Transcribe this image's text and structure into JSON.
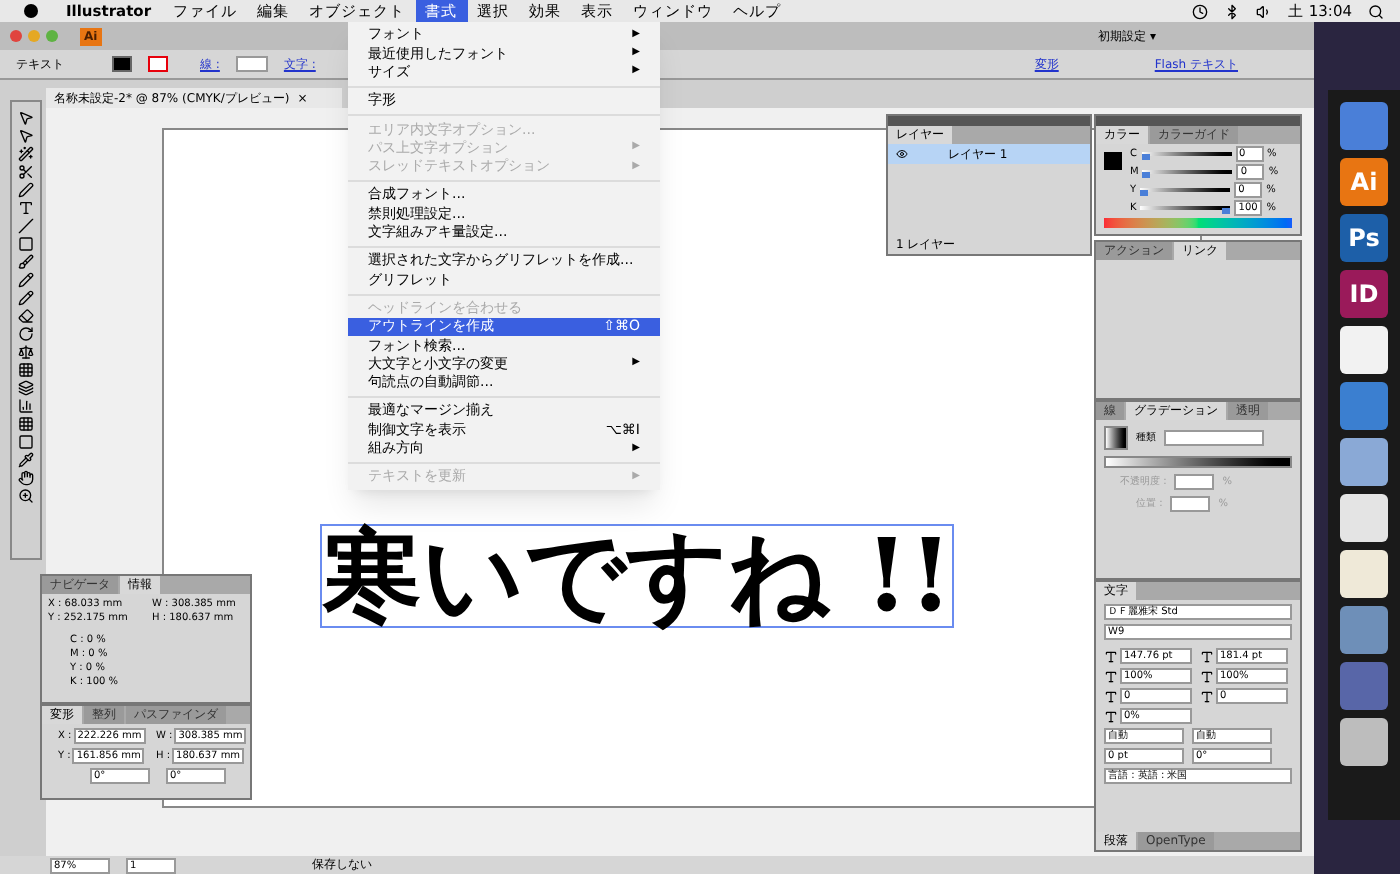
{
  "menubar": {
    "app": "Illustrator",
    "menus": [
      {
        "label": "ファイル",
        "selected": false
      },
      {
        "label": "編集",
        "selected": false
      },
      {
        "label": "オブジェクト",
        "selected": false
      },
      {
        "label": "書式",
        "selected": true
      },
      {
        "label": "選択",
        "selected": false
      },
      {
        "label": "効果",
        "selected": false
      },
      {
        "label": "表示",
        "selected": false
      },
      {
        "label": "ウィンドウ",
        "selected": false
      },
      {
        "label": "ヘルプ",
        "selected": false
      }
    ],
    "clock": "土 13:04"
  },
  "window": {
    "app_badge": "Ai",
    "workspace": "初期設定",
    "workspace_caret": "▾"
  },
  "control_bar": {
    "mode": "テキスト",
    "stroke_label": "線 :",
    "char_label": "文字 :",
    "transform_link": "変形",
    "flash_link": "Flash テキスト"
  },
  "document_tab": {
    "title": "名称未設定-2* @ 87% (CMYK/プレビュー)",
    "close": "×"
  },
  "menu": [
    {
      "kind": "item",
      "label": "フォント",
      "arrow": "▶",
      "disabled": false,
      "selected": false
    },
    {
      "kind": "item",
      "label": "最近使用したフォント",
      "arrow": "▶",
      "disabled": false,
      "selected": false
    },
    {
      "kind": "item",
      "label": "サイズ",
      "arrow": "▶",
      "disabled": false,
      "selected": false
    },
    {
      "kind": "separator"
    },
    {
      "kind": "item",
      "label": "字形",
      "disabled": false,
      "selected": false
    },
    {
      "kind": "separator"
    },
    {
      "kind": "item",
      "label": "エリア内文字オプション...",
      "disabled": true,
      "selected": false
    },
    {
      "kind": "item",
      "label": "パス上文字オプション",
      "arrow": "▶",
      "disabled": true,
      "selected": false
    },
    {
      "kind": "item",
      "label": "スレッドテキストオプション",
      "arrow": "▶",
      "disabled": true,
      "selected": false
    },
    {
      "kind": "separator"
    },
    {
      "kind": "item",
      "label": "合成フォント...",
      "disabled": false,
      "selected": false
    },
    {
      "kind": "item",
      "label": "禁則処理設定...",
      "disabled": false,
      "selected": false
    },
    {
      "kind": "item",
      "label": "文字組みアキ量設定...",
      "disabled": false,
      "selected": false
    },
    {
      "kind": "separator"
    },
    {
      "kind": "item",
      "label": "選択された文字からグリフレットを作成...",
      "disabled": false,
      "selected": false
    },
    {
      "kind": "item",
      "label": "グリフレット",
      "disabled": false,
      "selected": false
    },
    {
      "kind": "separator"
    },
    {
      "kind": "item",
      "label": "ヘッドラインを合わせる",
      "disabled": true,
      "selected": false
    },
    {
      "kind": "item",
      "label": "アウトラインを作成",
      "shortcut": "⇧⌘O",
      "disabled": false,
      "selected": true
    },
    {
      "kind": "item",
      "label": "フォント検索...",
      "disabled": false,
      "selected": false
    },
    {
      "kind": "item",
      "label": "大文字と小文字の変更",
      "arrow": "▶",
      "disabled": false,
      "selected": false
    },
    {
      "kind": "item",
      "label": "句読点の自動調節...",
      "disabled": false,
      "selected": false
    },
    {
      "kind": "separator"
    },
    {
      "kind": "item",
      "label": "最適なマージン揃え",
      "disabled": false,
      "selected": false
    },
    {
      "kind": "item",
      "label": "制御文字を表示",
      "shortcut": "⌥⌘I",
      "disabled": false,
      "selected": false
    },
    {
      "kind": "item",
      "label": "組み方向",
      "arrow": "▶",
      "disabled": false,
      "selected": false
    },
    {
      "kind": "separator"
    },
    {
      "kind": "item",
      "label": "テキストを更新",
      "arrow": "▶",
      "disabled": true,
      "selected": false
    }
  ],
  "canvas_text": "寒いですね !!",
  "layers_panel": {
    "tab": "レイヤー",
    "layer": "レイヤー 1",
    "footer": "1 レイヤー"
  },
  "color_panel": {
    "tabs": [
      {
        "label": "カラー",
        "selected": true
      },
      {
        "label": "カラーガイド",
        "selected": false
      }
    ],
    "channels": [
      {
        "name": "C",
        "value": "0",
        "level": 0
      },
      {
        "name": "M",
        "value": "0",
        "level": 0
      },
      {
        "name": "Y",
        "value": "0",
        "level": 0
      },
      {
        "name": "K",
        "value": "100",
        "level": 1
      }
    ],
    "unit": "%"
  },
  "actions_panel": {
    "tabs": [
      {
        "label": "アクション",
        "selected": false
      },
      {
        "label": "リンク",
        "selected": true
      }
    ]
  },
  "gradient_panel": {
    "tabs": [
      {
        "label": "線",
        "selected": false
      },
      {
        "label": "グラデーション",
        "selected": true
      },
      {
        "label": "透明",
        "selected": false
      }
    ],
    "type_label": "種類",
    "opacity_label": "不透明度 :",
    "position_label": "位置 :",
    "unit": "%"
  },
  "character_panel": {
    "tab": "文字",
    "font": "ＤＦ麗雅宋 Std",
    "style": "W9",
    "fields": [
      {
        "value": "147.76 pt"
      },
      {
        "value": "181.4 pt"
      },
      {
        "value": "100%"
      },
      {
        "value": "100%"
      },
      {
        "value": "0"
      },
      {
        "value": "0"
      },
      {
        "value": "0%"
      }
    ],
    "auto_1": "自動",
    "auto_2": "自動",
    "baseline": "0 pt",
    "rotation": "0°",
    "language": "言語 : 英語 : 米国",
    "bottom_tabs": [
      "段落",
      "OpenType"
    ]
  },
  "info_panel": {
    "tabs": [
      {
        "label": "ナビゲータ",
        "selected": false
      },
      {
        "label": "情報",
        "selected": true
      }
    ],
    "x": "X : 68.033 mm",
    "y": "Y : 252.175 mm",
    "w": "W : 308.385 mm",
    "h": "H : 180.637 mm",
    "cmyk": [
      "C : 0 %",
      "M : 0 %",
      "Y : 0 %",
      "K : 100 %"
    ]
  },
  "transform_panel": {
    "tabs": [
      {
        "label": "変形",
        "selected": true
      },
      {
        "label": "整列",
        "selected": false
      },
      {
        "label": "パスファインダ",
        "selected": false
      }
    ],
    "fields": [
      {
        "label": "X :",
        "value": "222.226 mm"
      },
      {
        "label": "W :",
        "value": "308.385 mm"
      },
      {
        "label": "Y :",
        "value": "161.856 mm"
      },
      {
        "label": "H :",
        "value": "180.637 mm"
      }
    ],
    "angle": "0°",
    "shear": "0°"
  },
  "status_bar": {
    "zoom": "87%",
    "page": "1",
    "status": "保存しない"
  },
  "dock": [
    {
      "color": "#4a7fd8"
    },
    {
      "label": "Ai",
      "color": "#e87512"
    },
    {
      "label": "Ps",
      "color": "#1d5fa8"
    },
    {
      "label": "ID",
      "color": "#9a1a5a"
    },
    {
      "color": "#f2f2f2"
    },
    {
      "color": "#3b7fd0"
    },
    {
      "color": "#8aa9d6"
    },
    {
      "color": "#e4e4e4"
    },
    {
      "color": "#efe9d8"
    },
    {
      "color": "#6e8fb8"
    },
    {
      "color": "#5866a8"
    },
    {
      "color": "#bdbdbd"
    }
  ]
}
